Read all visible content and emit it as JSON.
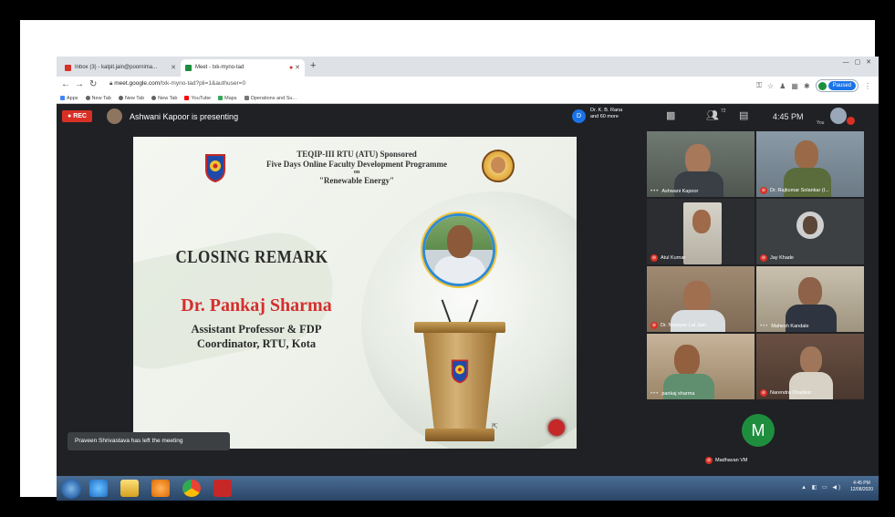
{
  "browser": {
    "tabs": [
      {
        "label": "Inbox (3) - kalpit.jain@poornima... ",
        "favicon_color": "#d93025"
      },
      {
        "label": "Meet - txk-myno-tad",
        "favicon_color": "#1e8e3e"
      }
    ],
    "url_host": "meet.google.com",
    "url_path": "/txk-myno-tad?pli=1&authuser=0",
    "paused_label": "Paused",
    "bookmarks": [
      "Apps",
      "New Tab",
      "New Tab",
      "New Tab",
      "YouTube",
      "Maps",
      "Operations and Su..."
    ]
  },
  "meet": {
    "rec_label": "REC",
    "presenting_text": "Ashwani Kapoor is presenting",
    "participants_avatar_letter": "D",
    "participants_line1": "Dr. K. B. Rana",
    "participants_line2": "and 60 more",
    "people_count": "72",
    "time": "4:45 PM",
    "you_label": "You",
    "toast": "Praveen Shrivastava has left the meeting"
  },
  "slide": {
    "header_line1": "TEQIP-III RTU (ATU) Sponsored",
    "header_line2": "Five Days Online Faculty Development Programme",
    "header_on": "on",
    "header_line3": "\"Renewable Energy\"",
    "closing": "CLOSING REMARK",
    "name": "Dr. Pankaj Sharma",
    "role_line1": "Assistant Professor & FDP",
    "role_line2": "Coordinator, RTU, Kota"
  },
  "tiles": [
    {
      "name": "Ashwani Kapoor",
      "muted": false
    },
    {
      "name": "Dr. Rajkumar Solankar (I...",
      "muted": true
    },
    {
      "name": "Atul Kumar",
      "muted": true
    },
    {
      "name": "Jay Khade",
      "muted": true
    },
    {
      "name": "Dr. Narayan Lal Jain",
      "muted": true
    },
    {
      "name": "Mahesh Kandale",
      "muted": false
    },
    {
      "name": "pankaj sharma",
      "muted": false
    },
    {
      "name": "Narendra Diradkar",
      "muted": true
    },
    {
      "name": "Madhavan VM",
      "muted": true,
      "avatar_letter": "M"
    }
  ],
  "taskbar": {
    "clock_time": "4:45 PM",
    "clock_date": "12/08/2020"
  }
}
